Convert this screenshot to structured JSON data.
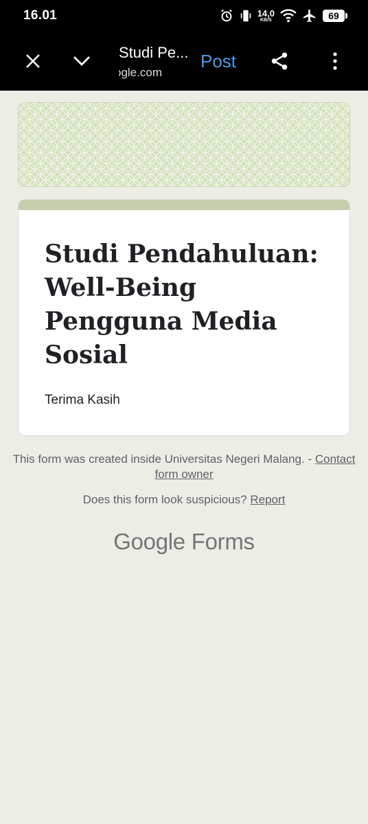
{
  "status_bar": {
    "time": "16.01",
    "net_speed_value": "14,0",
    "net_speed_unit": "KB/S",
    "battery": "69"
  },
  "toolbar": {
    "title": "Studi Pe...",
    "url": "ogle.com",
    "post_label": "Post",
    "icons": {
      "close": "close-icon",
      "chevron": "chevron-down-icon",
      "share": "share-icon",
      "more": "more-vert-icon"
    }
  },
  "form": {
    "title": "Studi Pendahuluan: Well-Being Pengguna Media Sosial",
    "description": "Terima Kasih"
  },
  "footer": {
    "created_text": "This form was created inside Universitas Negeri Malang. - ",
    "contact_link": "Contact form owner",
    "suspicious_text": "Does this form look suspicious? ",
    "report_link": "Report",
    "brand_google": "Google",
    "brand_forms": "Forms"
  },
  "colors": {
    "page_bg": "#ECEDE5",
    "banner_bg": "#D4E2BC",
    "card_accent": "#C5CFAE",
    "post_link": "#4A9BE8"
  }
}
